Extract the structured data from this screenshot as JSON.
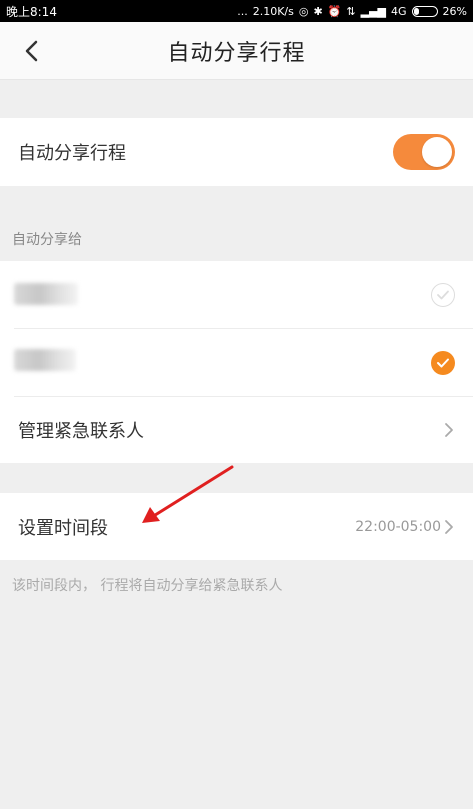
{
  "statusbar": {
    "time": "晚上8:14",
    "dots": "...",
    "speed": "2.10K/s",
    "network": "4G",
    "battery": "26%",
    "battery_level": 0.26
  },
  "navbar": {
    "title": "自动分享行程"
  },
  "auto_share": {
    "label": "自动分享行程",
    "enabled": true
  },
  "share_to": {
    "header": "自动分享给",
    "contacts": [
      {
        "selected": false
      },
      {
        "selected": true
      }
    ],
    "manage_label": "管理紧急联系人"
  },
  "time_period": {
    "label": "设置时间段",
    "value": "22:00-05:00",
    "note": "该时间段内， 行程将自动分享给紧急联系人"
  },
  "colors": {
    "accent": "#f58a3c",
    "annotation": "#e02020"
  }
}
